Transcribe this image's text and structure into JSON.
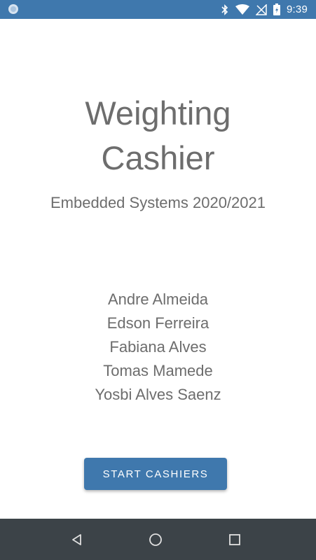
{
  "status_bar": {
    "time": "9:39",
    "icons": [
      "app-notification-icon",
      "bluetooth-icon",
      "wifi-icon",
      "no-signal-icon",
      "battery-icon"
    ],
    "background": "#3f78ad"
  },
  "main": {
    "title_line1": "Weighting",
    "title_line2": "Cashier",
    "subtitle": "Embedded Systems 2020/2021",
    "authors": [
      "Andre Almeida",
      "Edson Ferreira",
      "Fabiana Alves",
      "Tomas Mamede",
      "Yosbi Alves Saenz"
    ],
    "start_button_label": "START CASHIERS",
    "accent_color": "#3f78ad"
  },
  "nav_bar": {
    "icons": [
      "back-icon",
      "home-icon",
      "recents-icon"
    ],
    "background": "#3c4348"
  }
}
